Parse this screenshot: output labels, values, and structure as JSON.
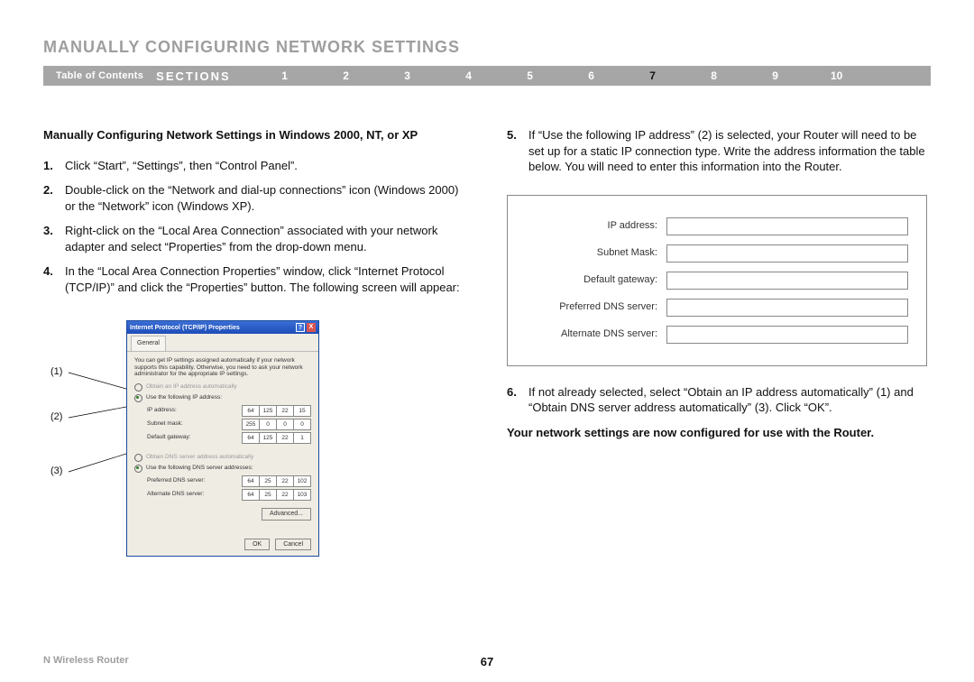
{
  "title": "MANUALLY CONFIGURING NETWORK SETTINGS",
  "nav": {
    "toc": "Table of Contents",
    "sections_label": "SECTIONS",
    "items": [
      "1",
      "2",
      "3",
      "4",
      "5",
      "6",
      "7",
      "8",
      "9",
      "10"
    ],
    "active": "7"
  },
  "subheading": "Manually Configuring Network Settings in Windows 2000, NT, or XP",
  "left_steps": [
    {
      "n": "1.",
      "t": "Click “Start”, “Settings”, then “Control Panel”."
    },
    {
      "n": "2.",
      "t": "Double-click on the “Network and dial-up connections” icon (Windows 2000) or the “Network” icon (Windows XP)."
    },
    {
      "n": "3.",
      "t": "Right-click on the “Local Area Connection” associated with your network adapter and select “Properties” from the drop-down menu."
    },
    {
      "n": "4.",
      "t": "In the “Local Area Connection Properties” window, click “Internet Protocol (TCP/IP)” and click the “Properties” button. The following screen will appear:"
    }
  ],
  "right_steps": [
    {
      "n": "5.",
      "t": "If “Use the following IP address” (2) is selected, your Router will need to be set up for a static IP connection type. Write the address information the table below. You will need to enter this information into the Router."
    },
    {
      "n": "6.",
      "t": "If not already selected, select “Obtain an IP address automatically” (1) and “Obtain DNS server address automatically” (3). Click “OK”."
    }
  ],
  "conclusion": "Your network settings are now configured for use with the Router.",
  "callouts": {
    "c1": "(1)",
    "c2": "(2)",
    "c3": "(3)"
  },
  "dialog": {
    "title": "Internet Protocol (TCP/IP) Properties",
    "tab": "General",
    "desc": "You can get IP settings assigned automatically if your network supports this capability. Otherwise, you need to ask your network administrator for the appropriate IP settings.",
    "r1": "Obtain an IP address automatically",
    "r2": "Use the following IP address:",
    "ip_label": "IP address:",
    "ip": [
      "64",
      "125",
      "22",
      "15"
    ],
    "mask_label": "Subnet mask:",
    "mask": [
      "255",
      "0",
      "0",
      "0"
    ],
    "gw_label": "Default gateway:",
    "gw": [
      "64",
      "125",
      "22",
      "1"
    ],
    "r3": "Obtain DNS server address automatically",
    "r4": "Use the following DNS server addresses:",
    "pdns_label": "Preferred DNS server:",
    "pdns": [
      "64",
      "25",
      "22",
      "102"
    ],
    "adns_label": "Alternate DNS server:",
    "adns": [
      "64",
      "25",
      "22",
      "103"
    ],
    "advanced": "Advanced...",
    "ok": "OK",
    "cancel": "Cancel"
  },
  "form_labels": {
    "ip": "IP address:",
    "mask": "Subnet Mask:",
    "gw": "Default gateway:",
    "pdns": "Preferred DNS server:",
    "adns": "Alternate DNS server:"
  },
  "footer_left": "N Wireless Router",
  "page_number": "67"
}
